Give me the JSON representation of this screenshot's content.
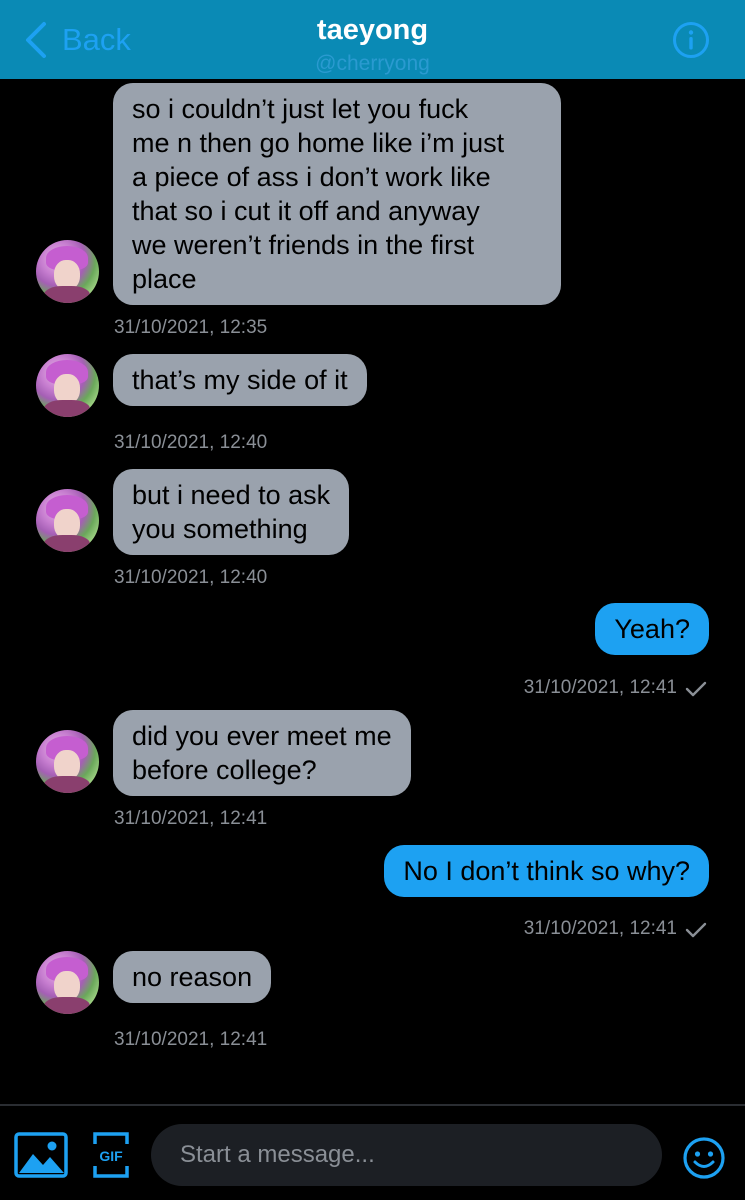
{
  "header": {
    "back_label": "Back",
    "title": "taeyong",
    "handle": "@cherryong"
  },
  "messages": [
    {
      "direction": "incoming",
      "text": "so i couldn’t just let you fuck\nme n then go home like i’m just\na piece of ass i don’t work like\nthat so i cut it off and anyway\nwe weren’t friends in the first\nplace",
      "timestamp": "31/10/2021, 12:35"
    },
    {
      "direction": "incoming",
      "text": "that’s my side of it",
      "timestamp": "31/10/2021, 12:40"
    },
    {
      "direction": "incoming",
      "text": "but i need to ask\nyou something",
      "timestamp": "31/10/2021, 12:40"
    },
    {
      "direction": "outgoing",
      "text": "Yeah?",
      "timestamp": "31/10/2021, 12:41"
    },
    {
      "direction": "incoming",
      "text": "did you ever meet me\nbefore college?",
      "timestamp": "31/10/2021, 12:41"
    },
    {
      "direction": "outgoing",
      "text": "No I don’t think so why?",
      "timestamp": "31/10/2021, 12:41"
    },
    {
      "direction": "incoming",
      "text": "no reason",
      "timestamp": "31/10/2021, 12:41"
    }
  ],
  "composer": {
    "placeholder": "Start a message...",
    "gif_label": "GIF",
    "icons": [
      "image-icon",
      "gif-icon",
      "emoji-icon"
    ]
  },
  "colors": {
    "header_bg": "#0a8ab5",
    "accent": "#1da1f2",
    "incoming_bubble": "#9aa2ad",
    "background": "#000000"
  }
}
